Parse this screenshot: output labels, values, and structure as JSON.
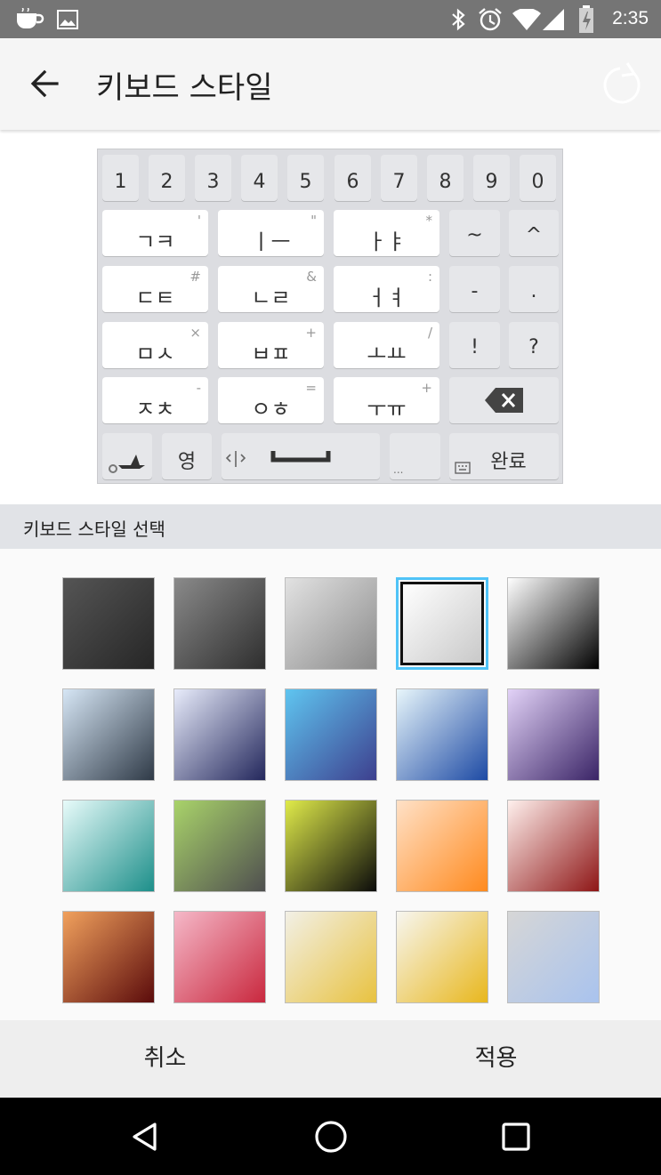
{
  "status_bar": {
    "time": "2:35",
    "icons_left": [
      "coffee-icon",
      "image-icon"
    ],
    "icons_right": [
      "bluetooth-icon",
      "alarm-icon",
      "wifi-icon",
      "signal-icon",
      "battery-icon"
    ]
  },
  "app_bar": {
    "title": "키보드 스타일",
    "back_icon": "arrow-left-icon",
    "reset_icon": "refresh-icon"
  },
  "keyboard_preview": {
    "row1": [
      "1",
      "2",
      "3",
      "4",
      "5",
      "6",
      "7",
      "8",
      "9",
      "0"
    ],
    "row2": [
      {
        "main": "ㄱㅋ",
        "sub": "'"
      },
      {
        "main": "ㅣㅡ",
        "sub": "\""
      },
      {
        "main": "ㅏㅑ",
        "sub": "*"
      },
      {
        "main": "~",
        "sub": ""
      },
      {
        "main": "^",
        "sub": ""
      }
    ],
    "row3": [
      {
        "main": "ㄷㅌ",
        "sub": "#"
      },
      {
        "main": "ㄴㄹ",
        "sub": "&"
      },
      {
        "main": "ㅓㅕ",
        "sub": ":"
      },
      {
        "main": "-",
        "sub": ""
      },
      {
        "main": ".",
        "sub": ""
      }
    ],
    "row4": [
      {
        "main": "ㅁㅅ",
        "sub": "×"
      },
      {
        "main": "ㅂㅍ",
        "sub": "+"
      },
      {
        "main": "ㅗㅛ",
        "sub": "/"
      },
      {
        "main": "!",
        "sub": ""
      },
      {
        "main": "?",
        "sub": ""
      }
    ],
    "row5": [
      {
        "main": "ㅈㅊ",
        "sub": "-"
      },
      {
        "main": "ㅇㅎ",
        "sub": "="
      },
      {
        "main": "ㅜㅠ",
        "sub": "+"
      }
    ],
    "row6": {
      "lang_key": "영",
      "more_key": "...",
      "done_key": "완료"
    }
  },
  "section": {
    "title": "키보드 스타일 선택"
  },
  "swatches": {
    "selected_index": 3,
    "colors": [
      [
        "#555555",
        "#262626"
      ],
      [
        "#8a8a8a",
        "#2e2e2e"
      ],
      [
        "#e2e2e2",
        "#8a8a8a"
      ],
      [
        "#ffffff",
        "#c9c9c9"
      ],
      [
        "#ffffff",
        "#000000"
      ],
      [
        "#d6e6f5",
        "#2f3a47"
      ],
      [
        "#e8ecfb",
        "#23275c"
      ],
      [
        "#5fc5f0",
        "#3d3f8e"
      ],
      [
        "#e8f6fb",
        "#1d4aa4"
      ],
      [
        "#e2d2f7",
        "#3a2466"
      ],
      [
        "#e8fbfa",
        "#1d8f8a"
      ],
      [
        "#a9d36a",
        "#4f4f4f"
      ],
      [
        "#e0eb4a",
        "#0b0b0b"
      ],
      [
        "#ffe1c7",
        "#ff8a1e"
      ],
      [
        "#fff0ed",
        "#8e1616"
      ],
      [
        "#f1a15d",
        "#5b0b0b"
      ],
      [
        "#f5b8c8",
        "#c9283e"
      ],
      [
        "#f2f0e6",
        "#e8c240"
      ],
      [
        "#f7f6f0",
        "#e8b71d"
      ],
      [
        "#d6d6d6",
        "#a9c3ee"
      ]
    ]
  },
  "actions": {
    "cancel": "취소",
    "apply": "적용"
  },
  "nav_bar": {
    "icons": [
      "back-triangle-icon",
      "home-circle-icon",
      "recents-square-icon"
    ]
  }
}
